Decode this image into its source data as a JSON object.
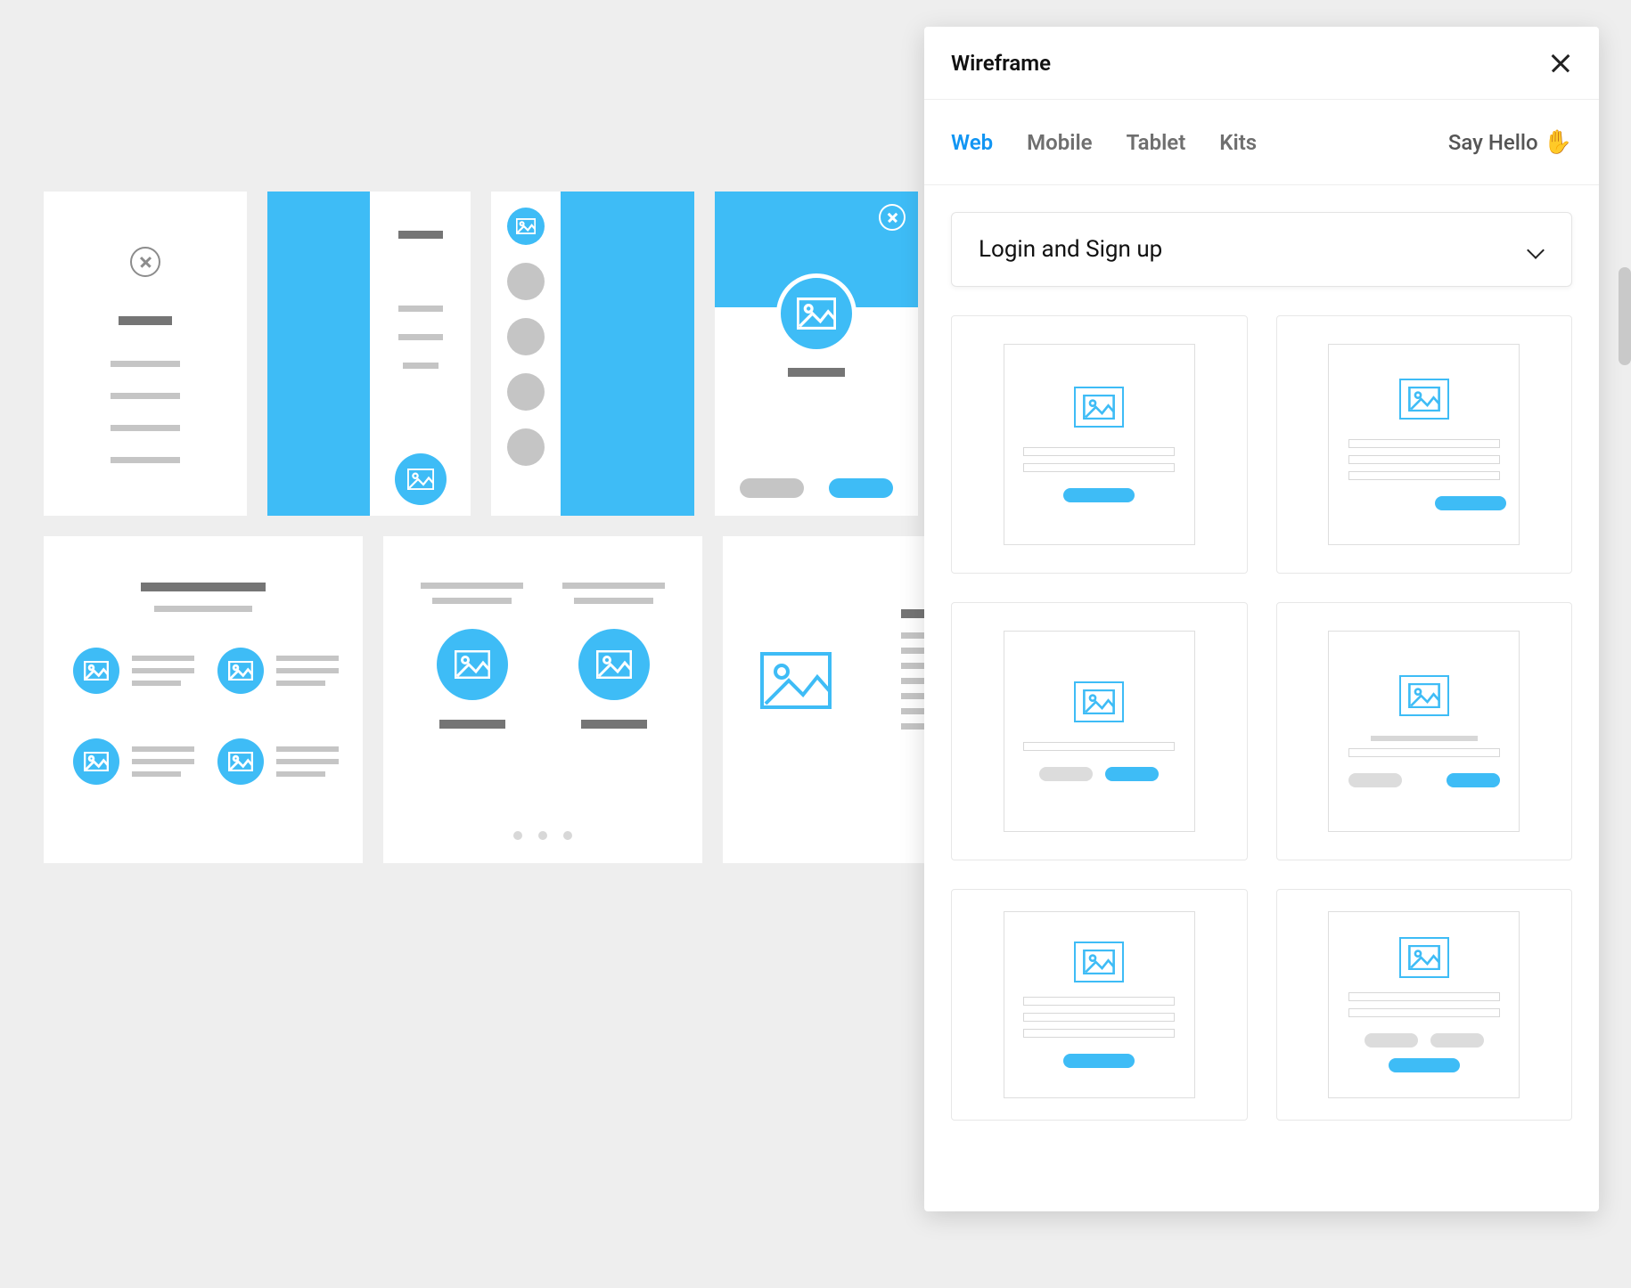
{
  "panel": {
    "title": "Wireframe",
    "tabs": [
      "Web",
      "Mobile",
      "Tablet",
      "Kits"
    ],
    "active_tab": "Web",
    "say_hello": "Say Hello",
    "wave_emoji": "✋",
    "dropdown_label": "Login and Sign up",
    "components": [
      {
        "id": "login-centered-1"
      },
      {
        "id": "login-centered-2"
      },
      {
        "id": "login-split-1"
      },
      {
        "id": "login-split-2"
      },
      {
        "id": "signup-multifield-1"
      },
      {
        "id": "signup-multifield-2"
      }
    ]
  },
  "colors": {
    "accent": "#3ebcf6",
    "accent_alt": "#1195f3",
    "gray": "#c5c5c5",
    "gray_dark": "#757575"
  },
  "canvas": {
    "cards_row1": [
      "modal-close",
      "sidebar-left",
      "nav-circle-column",
      "profile-hero"
    ],
    "cards_row2": [
      "features-grid",
      "features-columns",
      "article-image-left"
    ]
  }
}
